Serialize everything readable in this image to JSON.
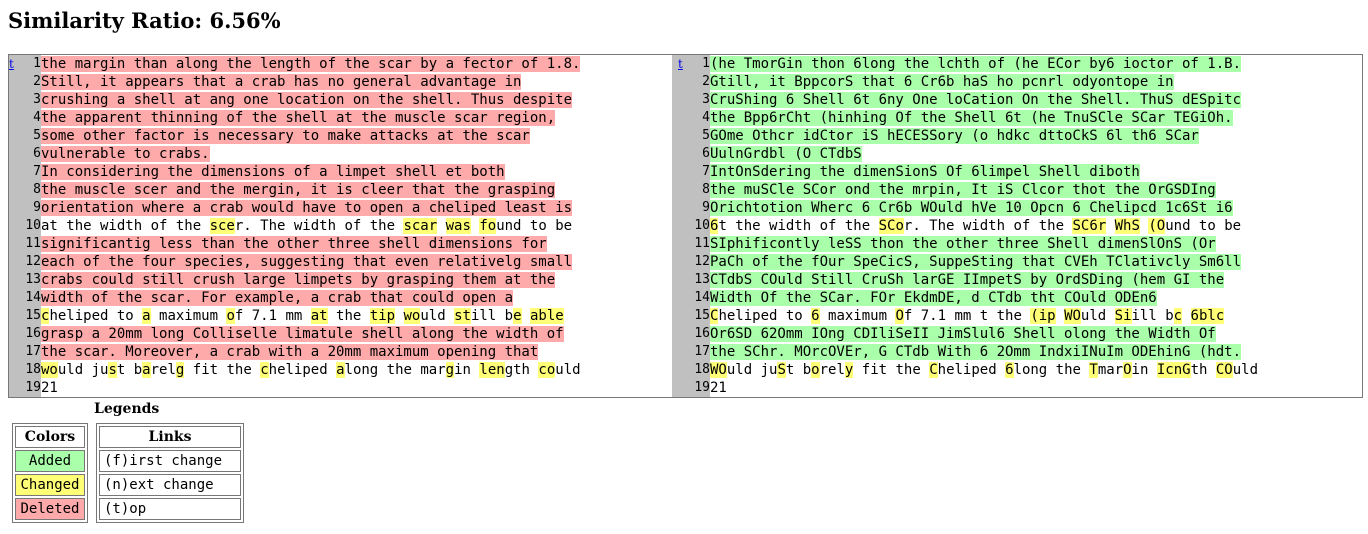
{
  "title": "Similarity Ratio: 6.56%",
  "nav": {
    "top_link": "t"
  },
  "left_lines": [
    {
      "n": "1",
      "segs": [
        {
          "t": "the margin than along the length of the scar by a fector of 1.8.",
          "c": "sub"
        }
      ]
    },
    {
      "n": "2",
      "segs": [
        {
          "t": "Still, it appears that a crab has no general advantage in",
          "c": "sub"
        }
      ]
    },
    {
      "n": "3",
      "segs": [
        {
          "t": "crushing a shell at ang one location on the shell. Thus despite",
          "c": "sub"
        }
      ]
    },
    {
      "n": "4",
      "segs": [
        {
          "t": "the apparent thinning of the shell at the muscle scar region,",
          "c": "sub"
        }
      ]
    },
    {
      "n": "5",
      "segs": [
        {
          "t": "some other factor is necessary to make attacks at the scar",
          "c": "sub"
        }
      ]
    },
    {
      "n": "6",
      "segs": [
        {
          "t": "vulnerable to crabs.",
          "c": "sub"
        }
      ]
    },
    {
      "n": "7",
      "segs": [
        {
          "t": "In considering the dimensions of a limpet shell et both",
          "c": "sub"
        }
      ]
    },
    {
      "n": "8",
      "segs": [
        {
          "t": "the muscle scer and the mergin, it is cleer that the grasping",
          "c": "sub"
        }
      ]
    },
    {
      "n": "9",
      "segs": [
        {
          "t": "orientation where a crab would have to open a cheliped least is",
          "c": "sub"
        }
      ]
    },
    {
      "n": "10",
      "segs": [
        {
          "t": "at the width of the ",
          "c": ""
        },
        {
          "t": "sce",
          "c": "chg"
        },
        {
          "t": "r. The width of the ",
          "c": ""
        },
        {
          "t": "scar",
          "c": "chg"
        },
        {
          "t": " ",
          "c": ""
        },
        {
          "t": "was",
          "c": "chg"
        },
        {
          "t": " ",
          "c": ""
        },
        {
          "t": "fo",
          "c": "chg"
        },
        {
          "t": "und to be",
          "c": ""
        }
      ]
    },
    {
      "n": "11",
      "segs": [
        {
          "t": "significantig less than the other three shell dimensions for",
          "c": "sub"
        }
      ]
    },
    {
      "n": "12",
      "segs": [
        {
          "t": "each of the four species, suggesting that even relativelg small",
          "c": "sub"
        }
      ]
    },
    {
      "n": "13",
      "segs": [
        {
          "t": "crabs could still crush large limpets by grasping them at the",
          "c": "sub"
        }
      ]
    },
    {
      "n": "14",
      "segs": [
        {
          "t": "width of the scar. For example, a crab that could open a",
          "c": "sub"
        }
      ]
    },
    {
      "n": "15",
      "segs": [
        {
          "t": "c",
          "c": "chg"
        },
        {
          "t": "heliped to ",
          "c": ""
        },
        {
          "t": "a",
          "c": "chg"
        },
        {
          "t": " maximum ",
          "c": ""
        },
        {
          "t": "o",
          "c": "chg"
        },
        {
          "t": "f 7.1 mm ",
          "c": ""
        },
        {
          "t": "at",
          "c": "chg"
        },
        {
          "t": " the ",
          "c": ""
        },
        {
          "t": "tip",
          "c": "chg"
        },
        {
          "t": " ",
          "c": ""
        },
        {
          "t": "wo",
          "c": "chg"
        },
        {
          "t": "uld ",
          "c": ""
        },
        {
          "t": "st",
          "c": "chg"
        },
        {
          "t": "ill b",
          "c": ""
        },
        {
          "t": "e",
          "c": "chg"
        },
        {
          "t": " ",
          "c": ""
        },
        {
          "t": "able",
          "c": "chg"
        }
      ]
    },
    {
      "n": "16",
      "segs": [
        {
          "t": "grasp a 20mm long Colliselle limatule shell along the width of",
          "c": "sub"
        }
      ]
    },
    {
      "n": "17",
      "segs": [
        {
          "t": "the scar. Moreover, a crab with a 20mm maximum opening that",
          "c": "sub"
        }
      ]
    },
    {
      "n": "18",
      "segs": [
        {
          "t": "wo",
          "c": "chg"
        },
        {
          "t": "uld ju",
          "c": ""
        },
        {
          "t": "s",
          "c": "chg"
        },
        {
          "t": "t b",
          "c": ""
        },
        {
          "t": "a",
          "c": "chg"
        },
        {
          "t": "rel",
          "c": ""
        },
        {
          "t": "g",
          "c": "chg"
        },
        {
          "t": " fit the ",
          "c": ""
        },
        {
          "t": "c",
          "c": "chg"
        },
        {
          "t": "heliped ",
          "c": ""
        },
        {
          "t": "a",
          "c": "chg"
        },
        {
          "t": "long the mar",
          "c": ""
        },
        {
          "t": "g",
          "c": "chg"
        },
        {
          "t": "in ",
          "c": ""
        },
        {
          "t": "len",
          "c": "chg"
        },
        {
          "t": "gth ",
          "c": ""
        },
        {
          "t": "co",
          "c": "chg"
        },
        {
          "t": "uld",
          "c": ""
        }
      ]
    },
    {
      "n": "19",
      "segs": [
        {
          "t": "21",
          "c": ""
        }
      ]
    }
  ],
  "right_lines": [
    {
      "n": "1",
      "segs": [
        {
          "t": "(he TmorGin thon 6long the lchth of (he ECor by6 ioctor of 1.B.",
          "c": "add"
        }
      ]
    },
    {
      "n": "2",
      "segs": [
        {
          "t": "Gtill, it BppcorS that 6 Cr6b haS ho pcnrl odyontope in",
          "c": "add"
        }
      ]
    },
    {
      "n": "3",
      "segs": [
        {
          "t": "CruShing 6 Shell 6t 6ny One loCation On the Shell. ThuS dESpitc",
          "c": "add"
        }
      ]
    },
    {
      "n": "4",
      "segs": [
        {
          "t": "the Bpp6rCht (hinhing Of the Shell 6t (he TnuSCle SCar TEGiOh.",
          "c": "add"
        }
      ]
    },
    {
      "n": "5",
      "segs": [
        {
          "t": "GOme Othcr idCtor iS hECESSory (o hdkc dttoCkS 6l th6 SCar",
          "c": "add"
        }
      ]
    },
    {
      "n": "6",
      "segs": [
        {
          "t": "UulnGrdbl (O CTdbS",
          "c": "add"
        }
      ]
    },
    {
      "n": "7",
      "segs": [
        {
          "t": "IntOnSdering the dimenSionS Of 6limpel Shell diboth",
          "c": "add"
        }
      ]
    },
    {
      "n": "8",
      "segs": [
        {
          "t": "the muSCle SCor ond the mrpin, It iS Clcor thot the OrGSDIng",
          "c": "add"
        }
      ]
    },
    {
      "n": "9",
      "segs": [
        {
          "t": "Orichtotion Wherc 6 Cr6b WOuld hVe 10 Opcn 6 Chelipcd 1c6St i6",
          "c": "add"
        }
      ]
    },
    {
      "n": "10",
      "segs": [
        {
          "t": "6",
          "c": "chg"
        },
        {
          "t": "t the width of the ",
          "c": ""
        },
        {
          "t": "SCo",
          "c": "chg"
        },
        {
          "t": "r. The width of the ",
          "c": ""
        },
        {
          "t": "SC6r",
          "c": "chg"
        },
        {
          "t": " ",
          "c": ""
        },
        {
          "t": "WhS",
          "c": "chg"
        },
        {
          "t": " ",
          "c": ""
        },
        {
          "t": "(O",
          "c": "chg"
        },
        {
          "t": "und to be",
          "c": ""
        }
      ]
    },
    {
      "n": "11",
      "segs": [
        {
          "t": "SIphificontly leSS thon the other three Shell dimenSlOnS (Or",
          "c": "add"
        }
      ]
    },
    {
      "n": "12",
      "segs": [
        {
          "t": "PaCh of the fOur SpeCicS, SuppeSting that CVEh TClativcly Sm6ll",
          "c": "add"
        }
      ]
    },
    {
      "n": "13",
      "segs": [
        {
          "t": "CTdbS COuld Still CruSh larGE IImpetS by OrdSDing (hem GI the",
          "c": "add"
        }
      ]
    },
    {
      "n": "14",
      "segs": [
        {
          "t": "Width Of the SCar. FOr EkdmDE, d CTdb tht COuld ODEn6",
          "c": "add"
        }
      ]
    },
    {
      "n": "15",
      "segs": [
        {
          "t": "C",
          "c": "chg"
        },
        {
          "t": "heliped to ",
          "c": ""
        },
        {
          "t": "6",
          "c": "chg"
        },
        {
          "t": " maximum ",
          "c": ""
        },
        {
          "t": "O",
          "c": "chg"
        },
        {
          "t": "f 7.1 mm t the ",
          "c": ""
        },
        {
          "t": "(ip",
          "c": "chg"
        },
        {
          "t": " ",
          "c": ""
        },
        {
          "t": "WO",
          "c": "chg"
        },
        {
          "t": "uld ",
          "c": ""
        },
        {
          "t": "Si",
          "c": "chg"
        },
        {
          "t": "ill b",
          "c": ""
        },
        {
          "t": "c",
          "c": "chg"
        },
        {
          "t": " ",
          "c": ""
        },
        {
          "t": "6blc",
          "c": "chg"
        }
      ]
    },
    {
      "n": "16",
      "segs": [
        {
          "t": "Or6SD 62Omm IOng CDIliSeII JimSlul6 Shell olong the Width Of",
          "c": "add"
        }
      ]
    },
    {
      "n": "17",
      "segs": [
        {
          "t": "the SChr. MOrcOVEr, G CTdb With 6 2Omm IndxiINuIm ODEhinG (hdt.",
          "c": "add"
        }
      ]
    },
    {
      "n": "18",
      "segs": [
        {
          "t": "WO",
          "c": "chg"
        },
        {
          "t": "uld ju",
          "c": ""
        },
        {
          "t": "S",
          "c": "chg"
        },
        {
          "t": "t b",
          "c": ""
        },
        {
          "t": "o",
          "c": "chg"
        },
        {
          "t": "rel",
          "c": ""
        },
        {
          "t": "y",
          "c": "chg"
        },
        {
          "t": " fit the ",
          "c": ""
        },
        {
          "t": "C",
          "c": "chg"
        },
        {
          "t": "heliped ",
          "c": ""
        },
        {
          "t": "6",
          "c": "chg"
        },
        {
          "t": "long the ",
          "c": ""
        },
        {
          "t": "T",
          "c": "chg"
        },
        {
          "t": "mar",
          "c": ""
        },
        {
          "t": "O",
          "c": "chg"
        },
        {
          "t": "in ",
          "c": ""
        },
        {
          "t": "IcnG",
          "c": "chg"
        },
        {
          "t": "th ",
          "c": ""
        },
        {
          "t": "CO",
          "c": "chg"
        },
        {
          "t": "uld",
          "c": ""
        }
      ]
    },
    {
      "n": "19",
      "segs": [
        {
          "t": "21",
          "c": ""
        }
      ]
    }
  ],
  "legend": {
    "title": "Legends",
    "colors_header": "Colors",
    "links_header": "Links",
    "added": "Added",
    "changed": "Changed",
    "deleted": "Deleted",
    "first_change": "(f)irst change",
    "next_change": "(n)ext change",
    "top": "(t)op"
  },
  "colors": {
    "added": "#aaffaa",
    "changed": "#ffff77",
    "deleted": "#ffaaaa",
    "gutter": "#c0c0c0"
  }
}
